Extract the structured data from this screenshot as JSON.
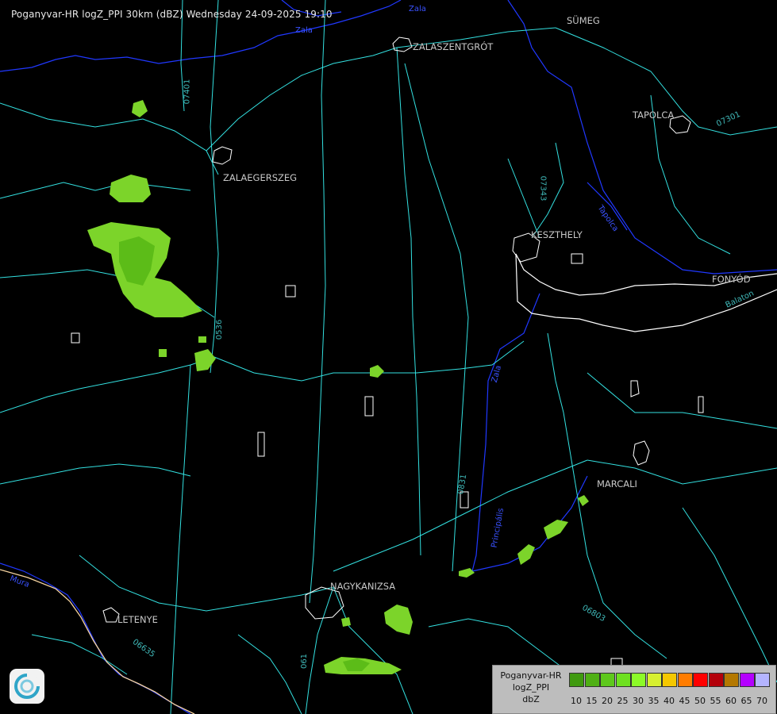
{
  "header": {
    "title": "Poganyvar-HR logZ_PPI 30km (dBZ) Wednesday 24-09-2025 19:10"
  },
  "cities": [
    {
      "name": "SÜMEG"
    },
    {
      "name": "ZALASZENTGRÓT"
    },
    {
      "name": "TAPOLCA"
    },
    {
      "name": "ZALAEGERSZEG"
    },
    {
      "name": "KESZTHELY"
    },
    {
      "name": "FONYÓD"
    },
    {
      "name": "MARCALI"
    },
    {
      "name": "NAGYKANIZSA"
    },
    {
      "name": "LETENYE"
    }
  ],
  "road_labels": [
    {
      "text": "07401"
    },
    {
      "text": "07343"
    },
    {
      "text": "07301"
    },
    {
      "text": "0536"
    },
    {
      "text": "0831"
    },
    {
      "text": "06803"
    },
    {
      "text": "06635"
    },
    {
      "text": "061"
    },
    {
      "text": "Balaton"
    }
  ],
  "river_labels": [
    {
      "text": "Zala"
    },
    {
      "text": "Zala"
    },
    {
      "text": "Tapolca"
    },
    {
      "text": "Zala"
    },
    {
      "text": "Mura"
    },
    {
      "text": "Principális"
    }
  ],
  "legend": {
    "line1": "Poganyvar-HR",
    "line2": "logZ_PPI",
    "line3": "dbZ",
    "scale": [
      {
        "value": "10",
        "color": "#3f9a0f"
      },
      {
        "value": "15",
        "color": "#4fb014"
      },
      {
        "value": "20",
        "color": "#5ec81c"
      },
      {
        "value": "25",
        "color": "#6ee020"
      },
      {
        "value": "30",
        "color": "#8cfa28"
      },
      {
        "value": "35",
        "color": "#d7f030"
      },
      {
        "value": "40",
        "color": "#f5c800"
      },
      {
        "value": "45",
        "color": "#ff7c00"
      },
      {
        "value": "50",
        "color": "#ff0000"
      },
      {
        "value": "55",
        "color": "#b4000a"
      },
      {
        "value": "60",
        "color": "#b47800"
      },
      {
        "value": "65",
        "color": "#b400ff"
      },
      {
        "value": "70",
        "color": "#b4b4ff"
      }
    ]
  },
  "colors": {
    "background": "#000000",
    "roads": "#33e0e0",
    "rivers": "#1e36ff",
    "settlements": "#ffffff",
    "echo_light": "#7cd42a",
    "echo_mid": "#5cbc18"
  },
  "icons": {
    "logo": "radar-logo-icon"
  }
}
